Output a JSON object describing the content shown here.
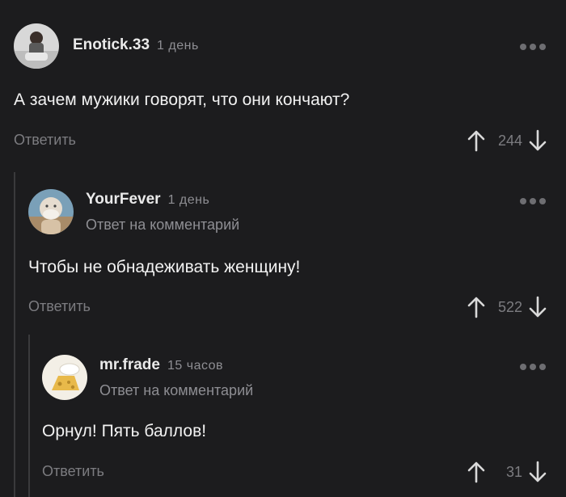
{
  "comments": [
    {
      "username": "Enotick.33",
      "time": "1 день",
      "text": "А зачем мужики говорят, что они кончают?",
      "reply_label": "Ответить",
      "votes": "244"
    },
    {
      "username": "YourFever",
      "time": "1 день",
      "reply_note": "Ответ на комментарий",
      "text": "Чтобы не обнадеживать женщину!",
      "reply_label": "Ответить",
      "votes": "522"
    },
    {
      "username": "mr.frade",
      "time": "15 часов",
      "reply_note": "Ответ на комментарий",
      "text": "Орнул! Пять баллов!",
      "reply_label": "Ответить",
      "votes": "31"
    }
  ],
  "icons": {
    "upvote": "arrow-up-icon",
    "downvote": "arrow-down-icon",
    "more": "more-options-icon"
  },
  "colors": {
    "background": "#1c1c1e",
    "muted_text": "#8e8e93",
    "primary_text": "#f2f2f2"
  }
}
